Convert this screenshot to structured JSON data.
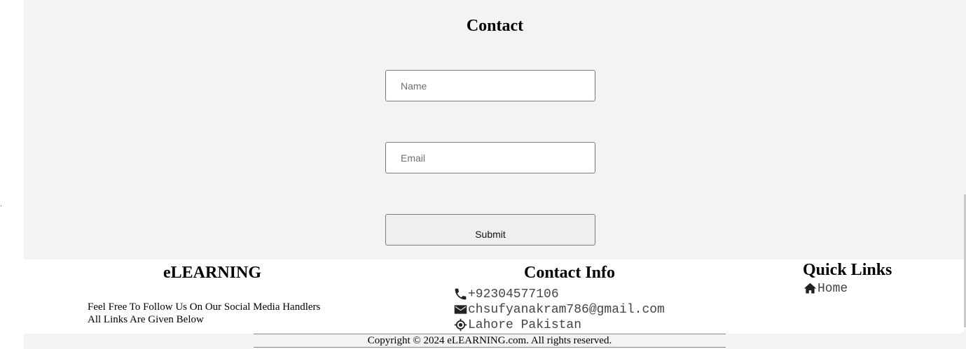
{
  "stray_mark": ".",
  "contact": {
    "title": "Contact",
    "name_placeholder": "Name",
    "email_placeholder": "Email",
    "submit_label": "Submit"
  },
  "footer": {
    "brand": {
      "title": "eLEARNING",
      "line1": "Feel Free To Follow Us On Our Social Media Handlers",
      "line2": "All Links Are Given Below"
    },
    "contact_info": {
      "title": "Contact Info",
      "phone": "+92304577106",
      "phone_icon": "phone-icon",
      "email": " chsufyanakram786@gmail.com",
      "email_icon": "envelope-icon",
      "location": "Lahore Pakistan",
      "location_icon": "location-crosshair-icon"
    },
    "quick_links": {
      "title": "Quick Links",
      "items": [
        {
          "label": " Home",
          "icon": "home-icon"
        }
      ]
    },
    "copyright": "Copyright © 2024 eLEARNING.com. All rights reserved."
  },
  "colors": {
    "section_bg": "#f3f3f3",
    "text": "#000000",
    "muted_text": "#444444"
  }
}
